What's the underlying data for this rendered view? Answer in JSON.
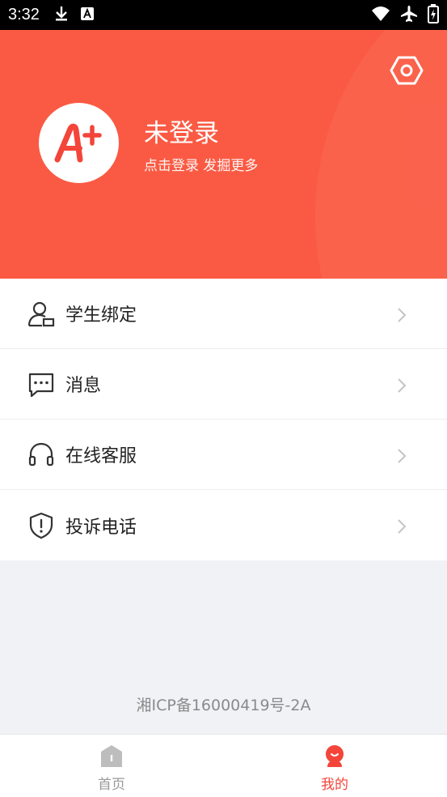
{
  "status_bar": {
    "time": "3:32"
  },
  "header": {
    "title": "未登录",
    "subtitle": "点击登录 发掘更多",
    "avatar_logo": "A+"
  },
  "menu": {
    "items": [
      {
        "label": "学生绑定",
        "icon": "student-user-icon"
      },
      {
        "label": "消息",
        "icon": "message-icon"
      },
      {
        "label": "在线客服",
        "icon": "headset-icon"
      },
      {
        "label": "投诉电话",
        "icon": "shield-alert-icon"
      }
    ]
  },
  "footer": {
    "icp": "湘ICP备16000419号-2A"
  },
  "tabbar": {
    "tabs": [
      {
        "label": "首页",
        "icon": "home-icon",
        "active": false
      },
      {
        "label": "我的",
        "icon": "mine-icon",
        "active": true
      }
    ]
  },
  "colors": {
    "accent": "#fa5a43",
    "tab_active": "#f4453a",
    "tab_inactive": "#9a9a9a",
    "background": "#f1f2f6"
  }
}
